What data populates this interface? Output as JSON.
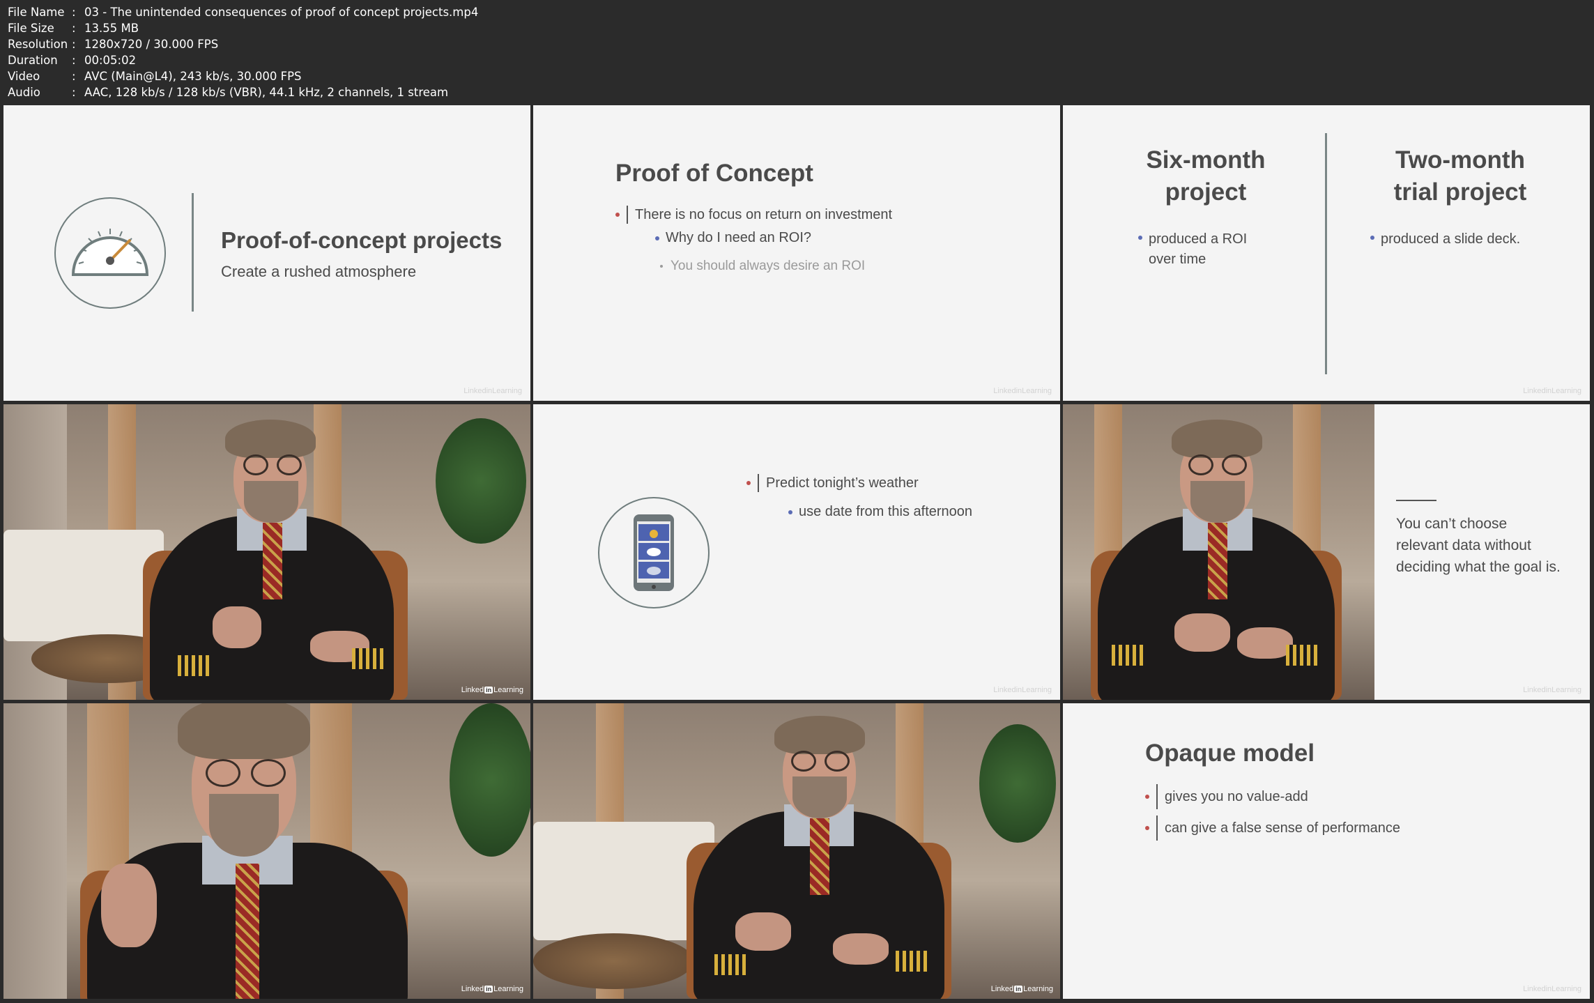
{
  "file_info": {
    "rows": [
      {
        "key": "File Name",
        "value": "03 - The unintended consequences of proof of concept projects.mp4"
      },
      {
        "key": "File Size",
        "value": "13.55 MB"
      },
      {
        "key": "Resolution",
        "value": "1280x720 / 30.000 FPS"
      },
      {
        "key": "Duration",
        "value": "00:05:02"
      },
      {
        "key": "Video",
        "value": "AVC (Main@L4), 243 kb/s, 30.000 FPS"
      },
      {
        "key": "Audio",
        "value": "AAC, 128 kb/s / 128 kb/s (VBR), 44.1 kHz, 2 channels, 1 stream"
      }
    ],
    "separator": ":"
  },
  "tiles": {
    "t1": {
      "title": "Proof-of-concept projects",
      "subtitle": "Create a rushed atmosphere",
      "icon": "gauge-icon"
    },
    "t2": {
      "title": "Proof of Concept",
      "l1": "There is no focus on return on investment",
      "l2": "Why do I need an ROI?",
      "l3": "You should always desire an ROI"
    },
    "t3": {
      "left_title_1": "Six-month",
      "left_title_2": "project",
      "left_b1": "produced a ROI",
      "left_b2": "over time",
      "right_title_1": "Two-month",
      "right_title_2": "trial project",
      "right_b1": "produced a slide deck."
    },
    "t5": {
      "l1": "Predict tonight’s weather",
      "l2": "use date from this afternoon",
      "icon": "phone-weather-icon"
    },
    "t6": {
      "quote_1": "You can’t choose",
      "quote_2": "relevant data without",
      "quote_3": "deciding what the goal is."
    },
    "t9": {
      "title": "Opaque model",
      "l1": "gives you no value-add",
      "l2": "can give a false sense of performance"
    }
  },
  "branding": {
    "linkedin_left": "Linked",
    "linkedin_in": "in",
    "linkedin_right": "Learning"
  },
  "colors": {
    "background": "#2b2b2b",
    "slide_bg": "#f4f4f4",
    "bullet_red": "#c0504d",
    "bullet_blue": "#5b6cb5"
  }
}
